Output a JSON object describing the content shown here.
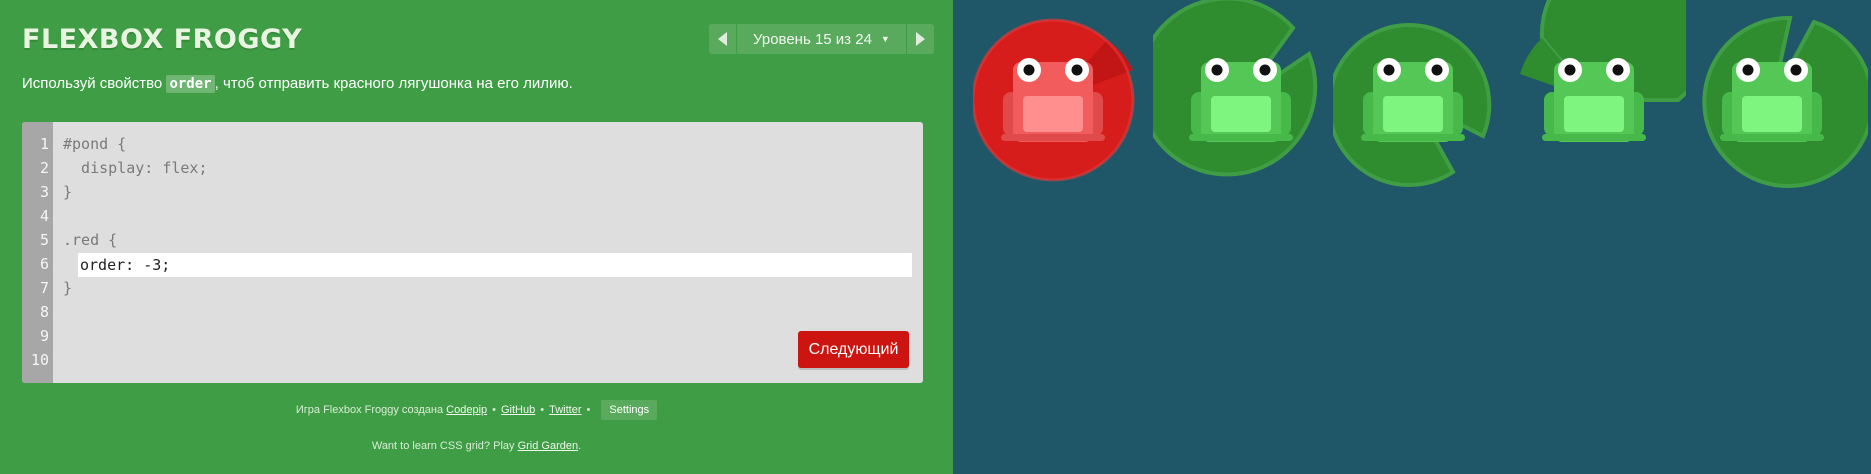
{
  "app": {
    "title": "FLEXBOX FROGGY"
  },
  "level_nav": {
    "indicator": "Уровень 15 из 24",
    "caret": "▼"
  },
  "instructions": {
    "before": "Используй свойство ",
    "property": "order",
    "after": ", чтоб отправить красного лягушонка на его лилию."
  },
  "editor": {
    "line_numbers": [
      "1",
      "2",
      "3",
      "4",
      "5",
      "6",
      "7",
      "8",
      "9",
      "10"
    ],
    "code_lines": [
      "#pond {",
      "  display: flex;",
      "}",
      "",
      ".red {",
      "",
      "}"
    ],
    "answer_value": "order: -3;",
    "next_label": "Следующий"
  },
  "footer": {
    "credit_text": "Игра Flexbox Froggy создана",
    "links": [
      "Codepip",
      "GitHub",
      "Twitter"
    ],
    "separator": "•",
    "settings_label": "Settings",
    "promo_text": "Want to learn CSS grid? Play ",
    "promo_link": "Grid Garden",
    "promo_end": "."
  },
  "board": {
    "colors": {
      "background": "#1f5768",
      "red_pad": "#d71c1c",
      "green_pad": "#2f8c2f",
      "red_frog": "#f25c5c",
      "green_frog": "#55c757"
    },
    "items": [
      {
        "color": "red",
        "pad": "lilypad-red"
      },
      {
        "color": "green",
        "pad": "lilypad-green"
      },
      {
        "color": "green",
        "pad": "lilypad-green"
      },
      {
        "color": "green",
        "pad": "lilypad-green"
      },
      {
        "color": "green",
        "pad": "lilypad-green"
      }
    ]
  }
}
